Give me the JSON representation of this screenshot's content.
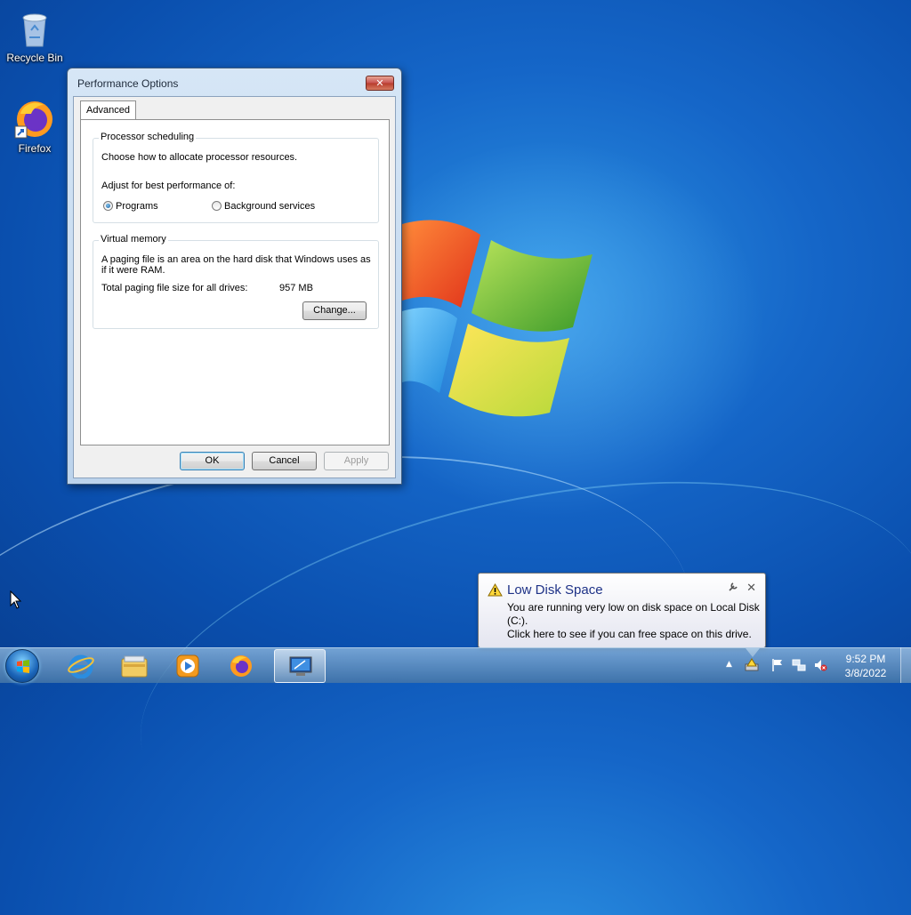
{
  "desktop": {
    "icons": [
      {
        "label": "Recycle Bin",
        "icon": "recycle-bin-icon"
      },
      {
        "label": "Firefox",
        "icon": "firefox-icon"
      }
    ]
  },
  "dialog": {
    "title": "Performance Options",
    "close_label": "✕",
    "tab": "Advanced",
    "processor": {
      "title": "Processor scheduling",
      "desc": "Choose how to allocate processor resources.",
      "adjust_label": "Adjust for best performance of:",
      "options": [
        {
          "label": "Programs",
          "selected": true
        },
        {
          "label": "Background services",
          "selected": false
        }
      ]
    },
    "virtual_memory": {
      "title": "Virtual memory",
      "desc_line1": "A paging file is an area on the hard disk that Windows uses as",
      "desc_line2": "if it were RAM.",
      "total_label": "Total paging file size for all drives:",
      "total_value": "957 MB",
      "change_button": "Change..."
    },
    "buttons": {
      "ok": "OK",
      "cancel": "Cancel",
      "apply": "Apply"
    }
  },
  "balloon": {
    "title": "Low Disk Space",
    "line1": "You are running very low on disk space on Local Disk",
    "line2": "(C:).",
    "line3": "Click here to see if you can free space on this drive.",
    "close_label": "✕"
  },
  "taskbar": {
    "items": [
      "internet-explorer-icon",
      "windows-explorer-icon",
      "media-player-icon",
      "firefox-icon",
      "system-properties-icon"
    ],
    "clock_time": "9:52 PM",
    "clock_date": "3/8/2022",
    "tray_arrow": "▲"
  }
}
